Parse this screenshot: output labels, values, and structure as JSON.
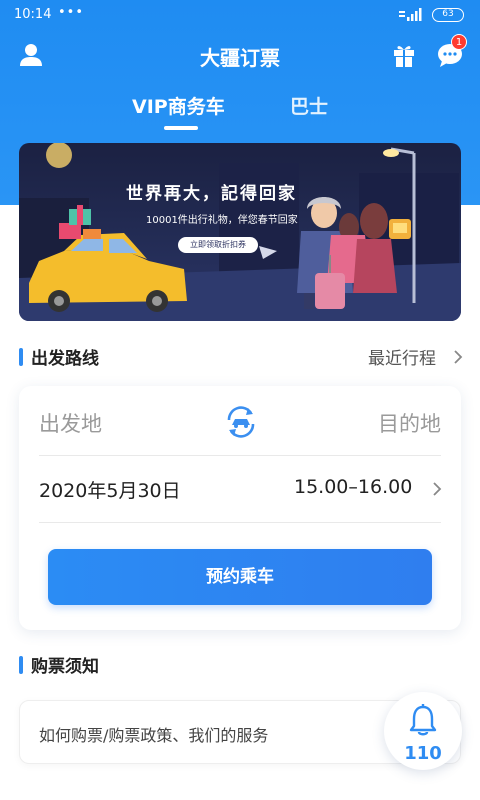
{
  "status_bar": {
    "time": "10:14",
    "dots": "•••",
    "battery": "63"
  },
  "header": {
    "title": "大疆订票",
    "message_badge": "1"
  },
  "tabs": [
    {
      "label": "VIP商务车",
      "active": true
    },
    {
      "label": "巴士",
      "active": false
    }
  ],
  "banner": {
    "headline": "世界再大，記得回家",
    "subline": "10001件出行礼物，伴您春节回家",
    "button": "立即领取折扣券"
  },
  "route_section": {
    "title": "出发路线",
    "recent_link": "最近行程",
    "origin_placeholder": "出发地",
    "destination_placeholder": "目的地",
    "date": "2020年5月30日",
    "time_range": "15.00–16.00",
    "book_button": "预约乘车"
  },
  "notice_section": {
    "title": "购票须知",
    "text": "如何购票/购票政策、我们的服务"
  },
  "notification": {
    "count": "110"
  },
  "colors": {
    "primary": "#2f8cf2",
    "header_bg": "#1f8cf2",
    "badge": "#ff3b30"
  }
}
